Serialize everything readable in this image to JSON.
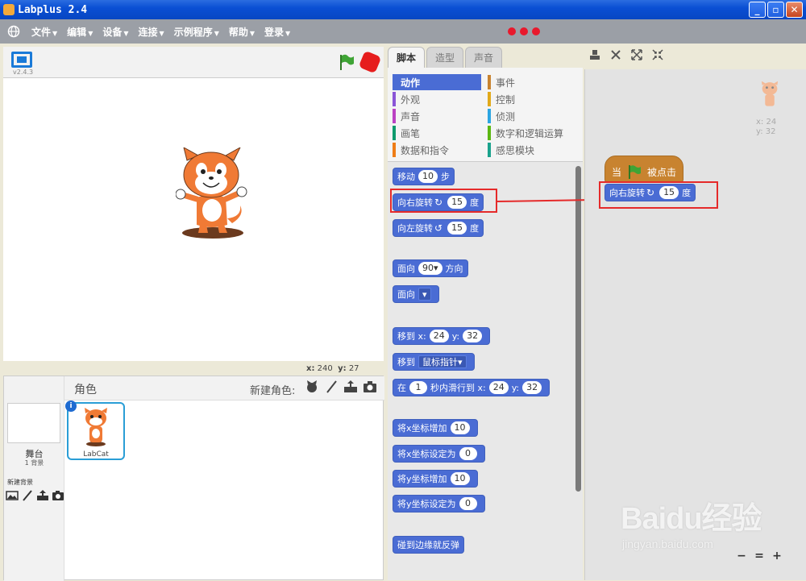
{
  "window": {
    "title": "Labplus 2.4",
    "buttons": [
      "_",
      "▫",
      "✕"
    ]
  },
  "menu": {
    "items": [
      "文件",
      "编辑",
      "设备",
      "连接",
      "示例程序",
      "帮助",
      "登录"
    ]
  },
  "stage": {
    "version": "v2.4.3",
    "coords": {
      "x_label": "x:",
      "x_value": "240",
      "y_label": "y:",
      "y_value": "27"
    }
  },
  "sprites_panel": {
    "title": "角色",
    "new_sprite_label": "新建角色:",
    "stage_name": "舞台",
    "stage_bg_count": "1 背景",
    "new_backdrop_label": "新建背景",
    "sprite": {
      "name": "LabCat",
      "info": "i"
    }
  },
  "tabs": [
    "脚本",
    "造型",
    "声音"
  ],
  "categories": [
    {
      "label": "动作",
      "color": "#4a6cd4",
      "selected": true
    },
    {
      "label": "事件",
      "color": "#c88330"
    },
    {
      "label": "外观",
      "color": "#8a55d7"
    },
    {
      "label": "控制",
      "color": "#e1a91a"
    },
    {
      "label": "声音",
      "color": "#bb42c3"
    },
    {
      "label": "侦测",
      "color": "#2ca5e2"
    },
    {
      "label": "画笔",
      "color": "#0e9a6c"
    },
    {
      "label": "数字和逻辑运算",
      "color": "#5cb712"
    },
    {
      "label": "数据和指令",
      "color": "#ee7d16"
    },
    {
      "label": "感思模块",
      "color": "#1aa28c"
    }
  ],
  "blocks": {
    "move": {
      "pre": "移动",
      "val": "10",
      "post": "步"
    },
    "turn_right": {
      "pre": "向右旋转",
      "icon": "↻",
      "val": "15",
      "post": "度"
    },
    "turn_left": {
      "pre": "向左旋转",
      "icon": "↺",
      "val": "15",
      "post": "度"
    },
    "point_dir": {
      "pre": "面向",
      "val": "90▾",
      "post": "方向"
    },
    "point_towards": {
      "pre": "面向",
      "val": "▾"
    },
    "goto_xy": {
      "pre": "移到",
      "x_label": "x:",
      "x": "24",
      "y_label": "y:",
      "y": "32"
    },
    "goto": {
      "pre": "移到",
      "val": "鼠标指针▾"
    },
    "glide": {
      "pre": "在",
      "secs": "1",
      "mid": "秒内滑行到",
      "x_label": "x:",
      "x": "24",
      "y_label": "y:",
      "y": "32"
    },
    "change_x": {
      "pre": "将x坐标增加",
      "val": "10"
    },
    "set_x": {
      "pre": "将x坐标设定为",
      "val": "0"
    },
    "change_y": {
      "pre": "将y坐标增加",
      "val": "10"
    },
    "set_y": {
      "pre": "将y坐标设定为",
      "val": "0"
    },
    "bounce": {
      "pre": "碰到边缘就反弹"
    }
  },
  "scripts": {
    "hat": {
      "pre": "当",
      "post": "被点击"
    },
    "turn_right": {
      "pre": "向右旋转",
      "icon": "↻",
      "val": "15",
      "post": "度"
    },
    "sprite_x": "x: 24",
    "sprite_y": "y: 32"
  },
  "zoom": [
    "−",
    "=",
    "+"
  ],
  "watermark": {
    "brand": "Baidu经验",
    "url": "jingyan.baidu.com"
  },
  "colors": {
    "motion": "#4a6cd4",
    "event": "#c88330",
    "highlight": "#e52a2a",
    "menubar": "#9b9fa6"
  }
}
